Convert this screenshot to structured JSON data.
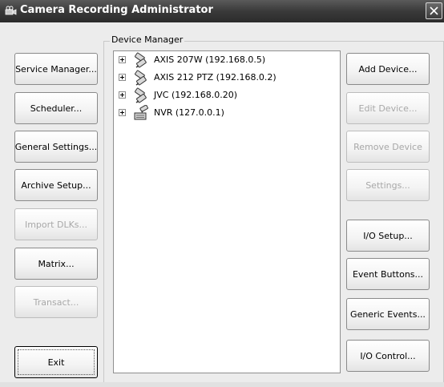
{
  "window": {
    "title": "Camera Recording Administrator",
    "icons": {
      "app": "camera-app-icon",
      "close": "close-icon"
    }
  },
  "left_buttons": [
    {
      "label": "Service Manager...",
      "enabled": true
    },
    {
      "label": "Scheduler...",
      "enabled": true
    },
    {
      "label": "General Settings...",
      "enabled": true
    },
    {
      "label": "Archive Setup...",
      "enabled": true
    },
    {
      "label": "Import DLKs...",
      "enabled": false
    },
    {
      "label": "Matrix...",
      "enabled": true
    },
    {
      "label": "Transact...",
      "enabled": false
    },
    {
      "label": "Exit",
      "enabled": true,
      "default": true
    }
  ],
  "device_manager": {
    "label": "Device Manager",
    "devices": [
      {
        "label": "AXIS 207W (192.168.0.5)",
        "icon": "camera-device-icon"
      },
      {
        "label": "AXIS 212 PTZ (192.168.0.2)",
        "icon": "camera-device-icon"
      },
      {
        "label": "JVC  (192.168.0.20)",
        "icon": "camera-device-icon"
      },
      {
        "label": "NVR (127.0.0.1)",
        "icon": "nvr-device-icon"
      }
    ]
  },
  "right_buttons": [
    {
      "label": "Add Device...",
      "enabled": true
    },
    {
      "label": "Edit Device...",
      "enabled": false
    },
    {
      "label": "Remove Device",
      "enabled": false
    },
    {
      "label": "Settings...",
      "enabled": false
    },
    {
      "label": "I/O Setup...",
      "enabled": true
    },
    {
      "label": "Event Buttons...",
      "enabled": true
    },
    {
      "label": "Generic Events...",
      "enabled": true
    },
    {
      "label": "I/O Control...",
      "enabled": true
    }
  ],
  "colors": {
    "titlebar": "#3a3a3a",
    "window_bg": "#ececec",
    "disabled_text": "#a8a8a8"
  }
}
